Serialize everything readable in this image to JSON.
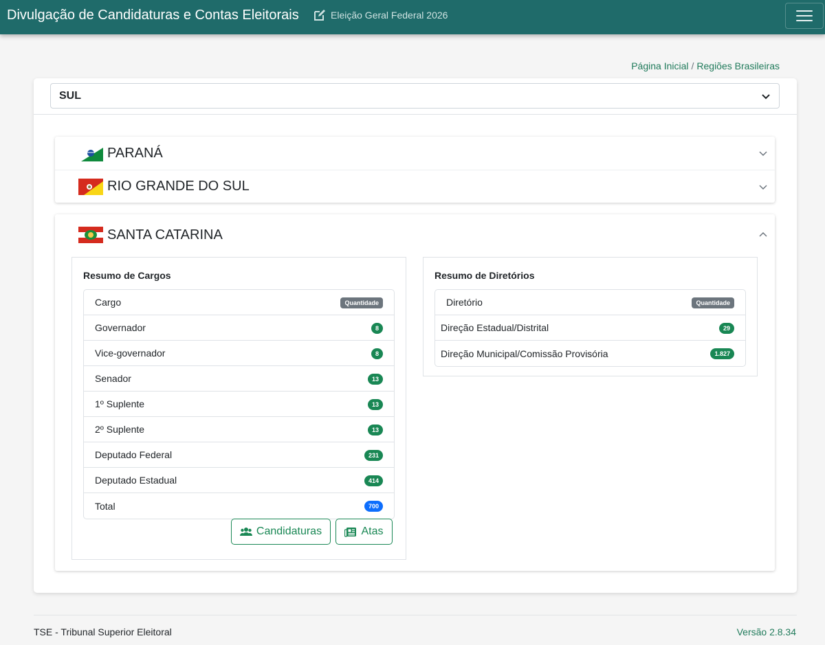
{
  "header": {
    "title": "Divulgação de Candidaturas e Contas Eleitorais",
    "election": "Eleição Geral Federal 2026"
  },
  "breadcrumb": {
    "home": "Página Inicial",
    "current": "Regiões Brasileiras"
  },
  "region_select": {
    "value": "SUL"
  },
  "states": [
    {
      "name": "PARANÁ",
      "expanded": false
    },
    {
      "name": "RIO GRANDE DO SUL",
      "expanded": false
    },
    {
      "name": "SANTA CATARINA",
      "expanded": true
    }
  ],
  "cargos": {
    "title": "Resumo de Cargos",
    "header_label": "Cargo",
    "header_badge": "Quantidade",
    "rows": [
      {
        "label": "Governador",
        "count": "8"
      },
      {
        "label": "Vice-governador",
        "count": "8"
      },
      {
        "label": "Senador",
        "count": "13"
      },
      {
        "label": "1º Suplente",
        "count": "13"
      },
      {
        "label": "2º Suplente",
        "count": "13"
      },
      {
        "label": "Deputado Federal",
        "count": "231"
      },
      {
        "label": "Deputado Estadual",
        "count": "414"
      },
      {
        "label": "Total",
        "count": "700"
      }
    ]
  },
  "diretorios": {
    "title": "Resumo de Diretórios",
    "header_label": "Diretório",
    "header_badge": "Quantidade",
    "rows": [
      {
        "label": "Direção Estadual/Distrital",
        "count": "29"
      },
      {
        "label": "Direção Municipal/Comissão Provisória",
        "count": "1.827"
      }
    ]
  },
  "buttons": {
    "candidaturas": "Candidaturas",
    "atas": "Atas"
  },
  "footer": {
    "left": "TSE - Tribunal Superior Eleitoral",
    "right": "Versão 2.8.34"
  },
  "colors": {
    "topbar": "#1f6b6a",
    "accent": "#198754",
    "total_badge": "#0d6efd"
  }
}
